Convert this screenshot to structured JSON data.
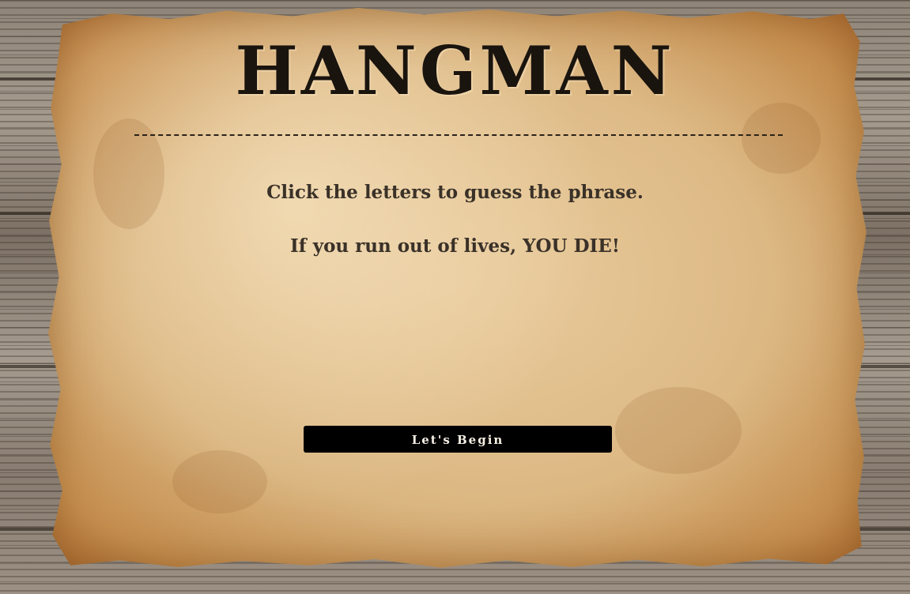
{
  "game": {
    "title": "HANGMAN",
    "instructions": [
      "Click the letters to guess the phrase.",
      "If you run out of lives, YOU DIE!"
    ],
    "start_button_label": "Let's Begin"
  },
  "colors": {
    "button_background": "#000000",
    "button_text": "#f5efe4",
    "title_text": "#1a140e",
    "instruction_text": "#3a3128",
    "parchment": "#e4c594"
  }
}
